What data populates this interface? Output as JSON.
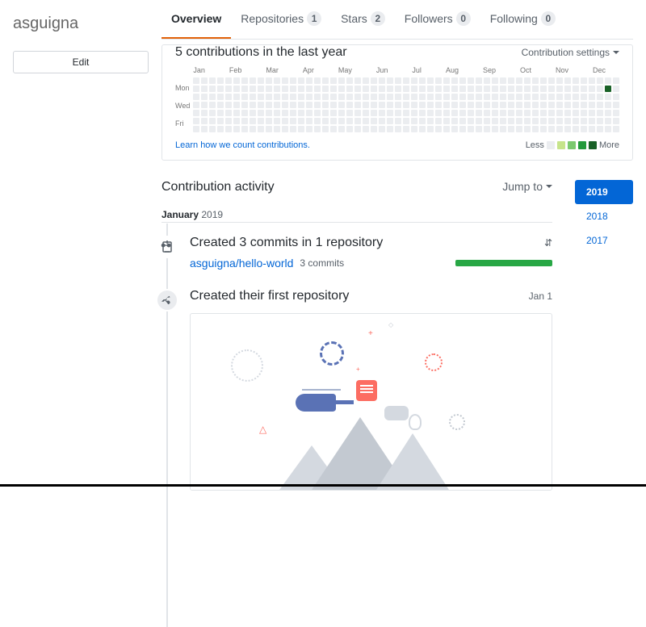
{
  "profile": {
    "username": "asguigna",
    "edit_button": "Edit"
  },
  "tabs": {
    "overview": "Overview",
    "repositories": {
      "label": "Repositories",
      "count": "1"
    },
    "stars": {
      "label": "Stars",
      "count": "2"
    },
    "followers": {
      "label": "Followers",
      "count": "0"
    },
    "following": {
      "label": "Following",
      "count": "0"
    }
  },
  "contrib": {
    "heading": "5 contributions in the last year",
    "settings": "Contribution settings",
    "months": [
      "Jan",
      "Feb",
      "Mar",
      "Apr",
      "May",
      "Jun",
      "Jul",
      "Aug",
      "Sep",
      "Oct",
      "Nov",
      "Dec"
    ],
    "days": [
      "Mon",
      "Wed",
      "Fri"
    ],
    "learn": "Learn how we count contributions.",
    "less": "Less",
    "more": "More"
  },
  "activity": {
    "heading": "Contribution activity",
    "jump_to": "Jump to",
    "month_strong": "January",
    "month_year": " 2019",
    "commits_title": "Created 3 commits in 1 repository",
    "repo_link": "asguigna/hello-world",
    "commits_count": "3 commits",
    "first_repo_title": "Created their first repository",
    "first_repo_date": "Jan 1"
  },
  "years": {
    "y2019": "2019",
    "y2018": "2018",
    "y2017": "2017"
  }
}
